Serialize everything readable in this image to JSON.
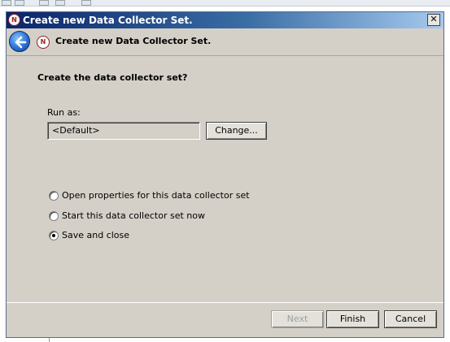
{
  "window": {
    "title": "Create new Data Collector Set.",
    "close_glyph": "✕"
  },
  "header": {
    "title": "Create new Data Collector Set."
  },
  "content": {
    "question": "Create the data collector set?",
    "run_as_label": "Run as:",
    "run_as_value": "<Default>",
    "change_button": "Change...",
    "options": [
      {
        "label": "Open properties for this data collector set",
        "selected": false
      },
      {
        "label": "Start this data collector set now",
        "selected": false
      },
      {
        "label": "Save and close",
        "selected": true
      }
    ]
  },
  "footer": {
    "next_label": "Next",
    "finish_label": "Finish",
    "cancel_label": "Cancel"
  },
  "colors": {
    "dialog_bg": "#d4d0c8",
    "titlebar_start": "#0a246a",
    "titlebar_end": "#a6caf0"
  },
  "icons": {
    "window": "data-collector-icon",
    "back": "back-arrow-icon",
    "header": "data-collector-icon"
  }
}
